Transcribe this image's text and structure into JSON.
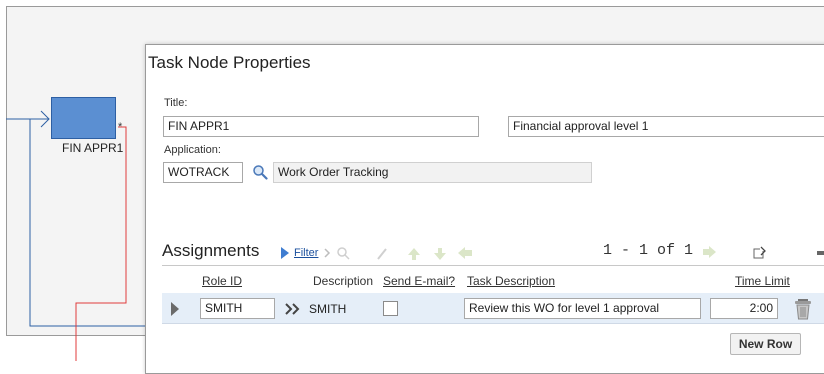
{
  "canvas": {
    "node_label": "FIN APPR1",
    "node_mark": "*"
  },
  "dialog": {
    "title": "Task Node Properties",
    "title_label": "Title:",
    "title_value": "FIN APPR1",
    "description_value": "Financial approval level 1",
    "application_label": "Application:",
    "application_value": "WOTRACK",
    "application_description": "Work Order Tracking"
  },
  "assignments": {
    "title": "Assignments",
    "filter_label": "Filter",
    "pager": "1 - 1 of 1",
    "columns": {
      "role_id": "Role ID",
      "description": "Description",
      "send_email": "Send E-mail?",
      "task_description": "Task Description",
      "time_limit": "Time Limit"
    },
    "rows": [
      {
        "role_id": "SMITH",
        "description": "SMITH",
        "send_email": false,
        "task_description": "Review this WO for level 1 approval",
        "time_limit": "2:00"
      }
    ],
    "new_row_label": "New Row"
  },
  "icons": {
    "lookup": "magnifier-icon",
    "filter": "filter-arrow-icon",
    "expand_row": "expand-row-icon",
    "detail_menu": "double-chevron-icon",
    "delete": "trash-icon",
    "download": "download-icon",
    "collapse": "minimize-icon"
  },
  "colors": {
    "node_fill": "#5b8fd2",
    "connector_red": "#e03b3b",
    "connector_blue": "#2d5fa3",
    "row_bg": "#e5eef8",
    "link": "#1a4f9c"
  }
}
